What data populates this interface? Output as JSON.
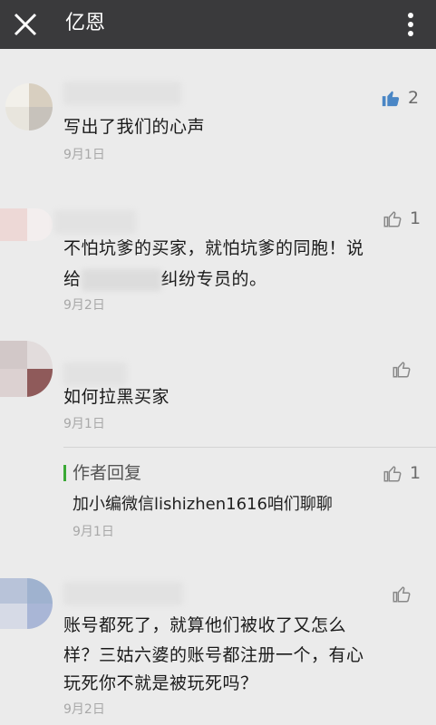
{
  "header": {
    "title": "亿恩",
    "close_icon": "close-icon",
    "more_icon": "more-vertical-icon",
    "background": "#3a3a3c"
  },
  "comments": [
    {
      "content": "写出了我们的心声",
      "date": "9月1日",
      "likes": "2",
      "liked": true
    },
    {
      "content_line1": "不怕坑爹的买家，就怕坑爹的同胞！说",
      "content_line2_a": "给",
      "content_line2_b": "纠纷专员的。",
      "date": "9月2日",
      "likes": "1",
      "liked": false
    },
    {
      "content": "如何拉黑买家",
      "date": "9月1日",
      "likes": "",
      "liked": false,
      "reply": {
        "label": "作者回复",
        "content": "加小编微信lishizhen1616咱们聊聊",
        "date": "9月1日",
        "likes": "1"
      }
    },
    {
      "content_line1": "账号都死了，就算他们被收了又怎么",
      "content_line2": "样？三姑六婆的账号都注册一个，有心",
      "content_line3": "玩死你不就是被玩死吗？",
      "date": "9月2日",
      "likes": "",
      "liked": false
    }
  ],
  "colors": {
    "like_active": "#4a86c5",
    "like_inactive": "#9a9a9a",
    "reply_accent": "#3aa935"
  }
}
